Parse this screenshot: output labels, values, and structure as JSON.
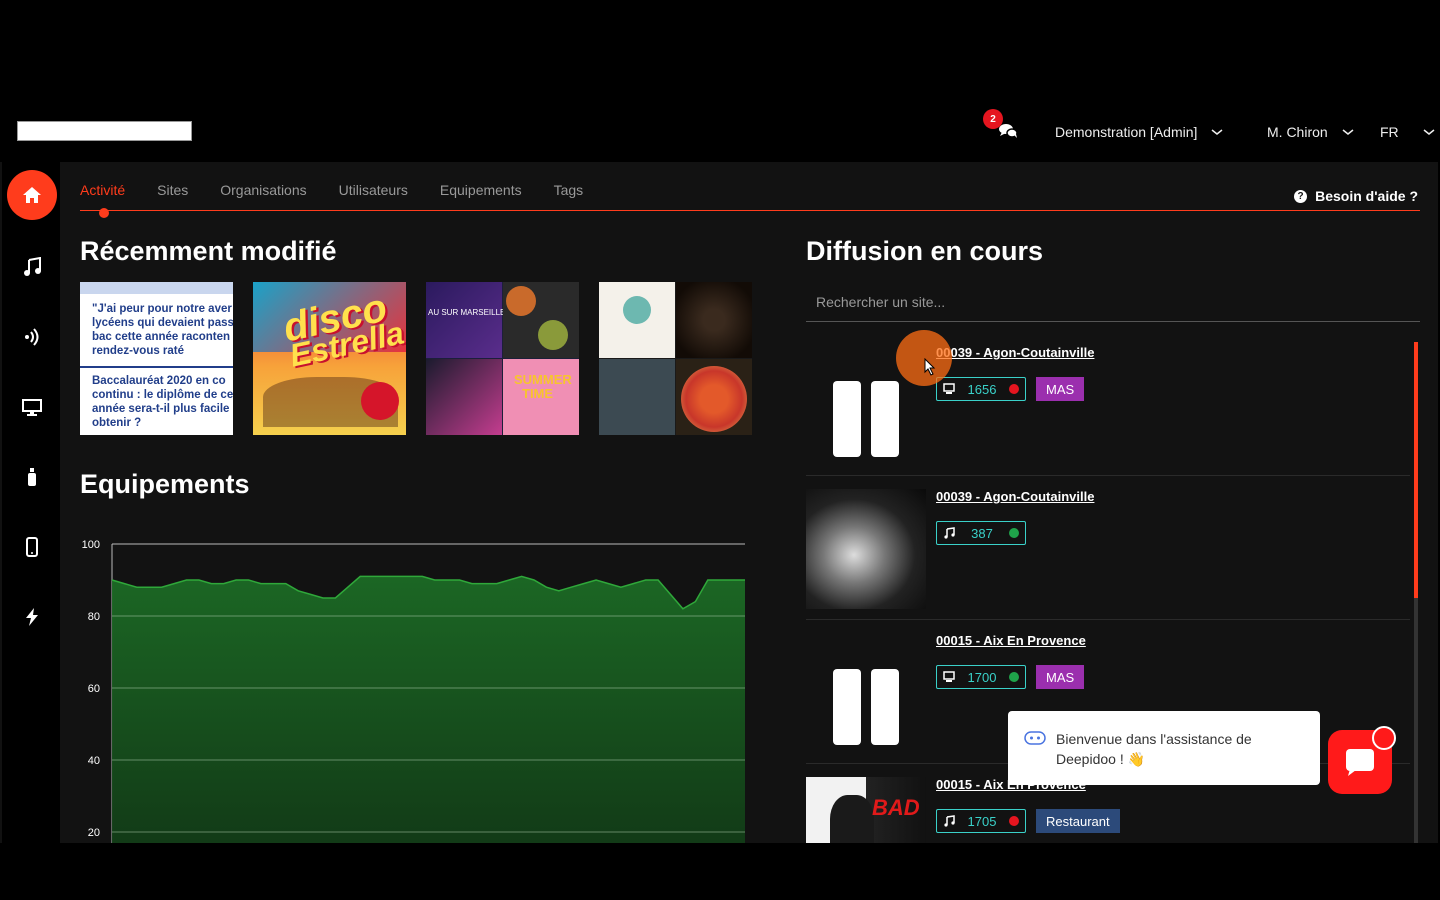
{
  "header": {
    "notifications_count": "2",
    "account": "Demonstration [Admin]",
    "user": "M. Chiron",
    "language": "FR"
  },
  "sidebar": {
    "items": [
      "home-icon",
      "music-icon",
      "broadcast-icon",
      "monitor-icon",
      "bottle-icon",
      "phone-icon",
      "lightning-icon"
    ]
  },
  "tabs": [
    "Activité",
    "Sites",
    "Organisations",
    "Utilisateurs",
    "Equipements",
    "Tags"
  ],
  "help_label": "Besoin d'aide ?",
  "recent": {
    "title": "Récemment modifié",
    "thumb1_lines": [
      "\"J'ai peur pour notre aver",
      "lycéens qui devaient pass",
      "bac cette année raconten",
      "rendez-vous raté",
      "Baccalauréat 2020 en co",
      "continu : le diplôme de ce",
      "année sera-t-il plus facile",
      "obtenir ?"
    ],
    "thumb2_text": [
      "disco",
      "Estrella"
    ],
    "thumb3_text": [
      "AU SUR MARSEILLE !",
      "SUMMER",
      "TIME"
    ]
  },
  "equipments": {
    "title": "Equipements"
  },
  "chart_data": {
    "type": "area",
    "title": "",
    "xlabel": "",
    "ylabel": "",
    "ylim": [
      0,
      100
    ],
    "y_ticks": [
      20,
      40,
      60,
      80,
      100
    ],
    "series": [
      {
        "values": [
          90,
          89,
          88,
          88,
          88,
          89,
          90,
          90,
          89,
          89,
          90,
          90,
          89,
          89,
          89,
          87,
          86,
          85,
          85,
          88,
          91,
          91,
          91,
          91,
          91,
          91,
          90,
          90,
          90,
          89,
          89,
          89,
          90,
          91,
          90,
          88,
          87,
          88,
          89,
          90,
          89,
          88,
          89,
          90,
          90,
          86,
          82,
          84,
          90,
          90,
          90,
          90
        ]
      }
    ]
  },
  "diffusion": {
    "title": "Diffusion en cours",
    "search_placeholder": "Rechercher un site...",
    "rows": [
      {
        "site": "00039 - Agon-Coutainville",
        "device_type": "monitor-icon",
        "device_id": "1656",
        "status": "#e5151f",
        "tag": "MAS",
        "tag_color": "#9b2fae",
        "art": "pause"
      },
      {
        "site": "00039 - Agon-Coutainville",
        "device_type": "music-icon",
        "device_id": "387",
        "status": "#1fa34a",
        "tag": "",
        "art": "album-scorpions"
      },
      {
        "site": "00015 - Aix En Provence",
        "device_type": "monitor-icon",
        "device_id": "1700",
        "status": "#1fa34a",
        "tag": "MAS",
        "tag_color": "#9b2fae",
        "art": "pause"
      },
      {
        "site": "00015 - Aix En Provence",
        "device_type": "music-icon",
        "device_id": "1705",
        "status": "#e5151f",
        "tag": "Restaurant",
        "tag_color": "#2c4a7a",
        "art": "album-bad"
      }
    ]
  },
  "assistant": {
    "welcome": "Bienvenue dans l'assistance de Deepidoo ! 👋"
  },
  "colors": {
    "accent": "#ff3c1c",
    "chart_fill": "#1c6b25",
    "chart_line": "#2fa83a"
  }
}
